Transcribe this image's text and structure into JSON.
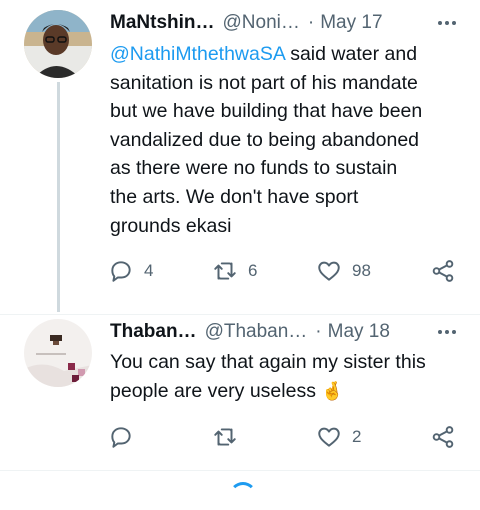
{
  "tweets": [
    {
      "name": "MaNtshin…",
      "handle": "@Noni…",
      "separator": "·",
      "date": "May 17",
      "mention": "@NathiMthethwaSA",
      "text_lines": [
        " said water and",
        "sanitation is not part of his mandate",
        "but we have building that have been",
        "vandalized due to being abandoned",
        "as there were no funds to sustain",
        "the arts. We don't have sport",
        "grounds ekasi"
      ],
      "replies": "4",
      "retweets": "6",
      "likes": "98"
    },
    {
      "name": "Thaban…",
      "handle": "@Thaban…",
      "separator": "·",
      "date": "May 18",
      "text_lines": [
        "You can say that again my sister this",
        "people are very useless "
      ],
      "emoji": "🤞",
      "replies": "",
      "retweets": "",
      "likes": "2"
    }
  ],
  "icons": [
    "reply-icon",
    "retweet-icon",
    "like-icon",
    "share-icon",
    "more-icon"
  ],
  "colors": {
    "mention": "#1d9bf0",
    "secondary_text": "#536471",
    "thread_line": "#cfd9de"
  }
}
